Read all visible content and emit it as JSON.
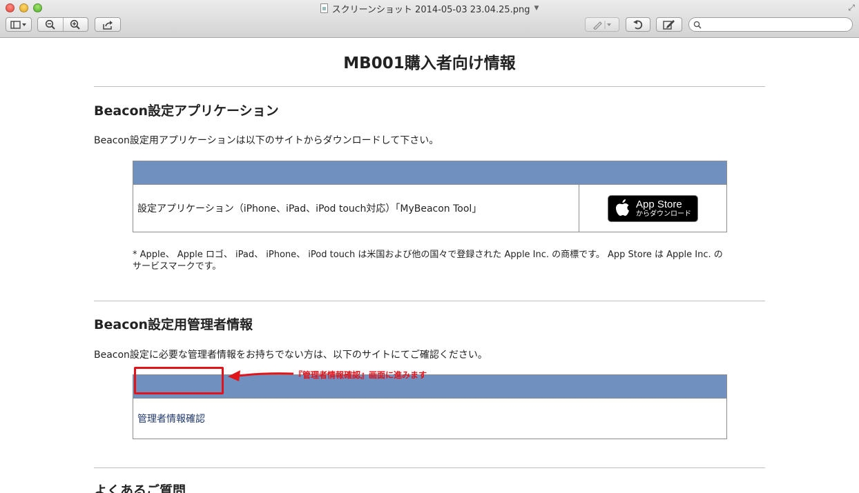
{
  "window": {
    "title": "スクリーンショット 2014-05-03 23.04.25.png",
    "search_placeholder": ""
  },
  "page": {
    "title": "MB001購入者向け情報",
    "section1": {
      "heading": "Beacon設定アプリケーション",
      "description": "Beacon設定用アプリケーションは以下のサイトからダウンロードして下さい。",
      "row_label": "設定アプリケーション（iPhone、iPad、iPod touch対応）「MyBeacon Tool」",
      "badge_big": "App Store",
      "badge_small": "からダウンロード",
      "footnote": "* Apple、 Apple ロゴ、 iPad、 iPhone、 iPod touch は米国および他の国々で登録された Apple Inc. の商標です。 App Store は Apple Inc. のサービスマークです。"
    },
    "section2": {
      "heading": "Beacon設定用管理者情報",
      "description": "Beacon設定に必要な管理者情報をお持ちでない方は、以下のサイトにてご確認ください。",
      "link_label": "管理者情報確認",
      "annotation": "『管理者情報確認』画面に進みます"
    },
    "section3": {
      "heading": "よくあるご質問"
    }
  },
  "colors": {
    "table_header": "#7090c0",
    "annotation_red": "#e0141b"
  },
  "icons": [
    "sidebar-toggle-icon",
    "zoom-out-icon",
    "zoom-in-icon",
    "share-icon",
    "markup-pen-icon",
    "rotate-icon",
    "edit-icon",
    "search-icon",
    "apple-logo-icon"
  ]
}
